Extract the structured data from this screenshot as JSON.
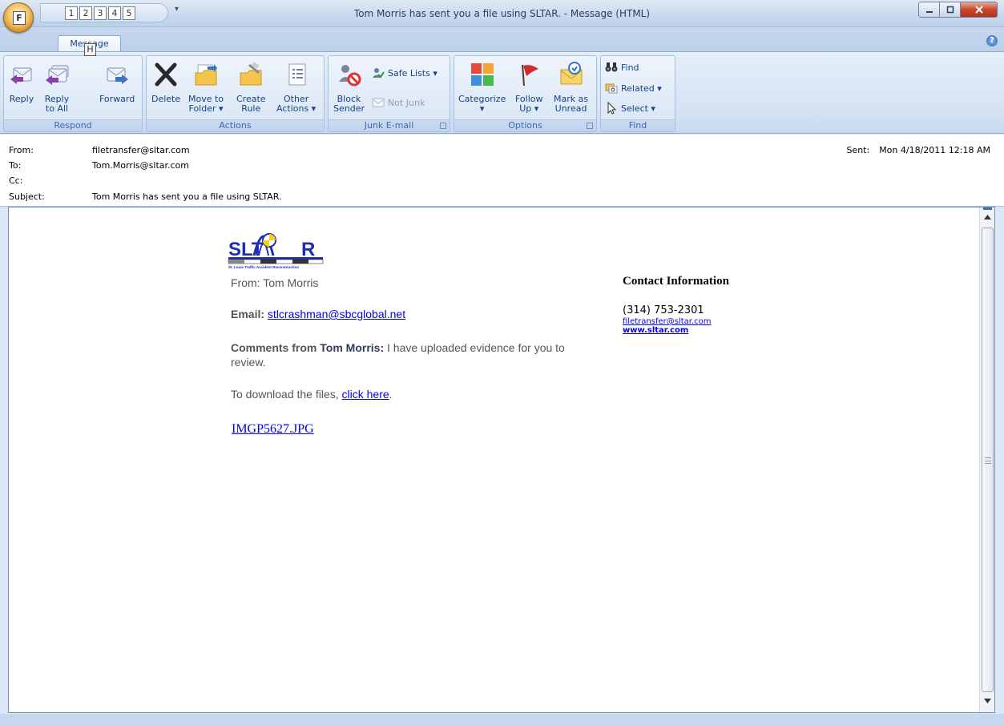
{
  "window": {
    "title": "Tom Morris has sent you a file using SLTAR. - Message (HTML)"
  },
  "office_button": {
    "keytip": "F"
  },
  "quick_access": {
    "keytips": [
      "1",
      "2",
      "3",
      "4",
      "5"
    ],
    "more": "▾"
  },
  "ribbon": {
    "tab": "Message",
    "tab_keytip": "H",
    "groups": {
      "respond": {
        "label": "Respond",
        "reply": "Reply",
        "reply_all_1": "Reply",
        "reply_all_2": "to All",
        "forward": "Forward"
      },
      "actions": {
        "label": "Actions",
        "delete": "Delete",
        "move_1": "Move to",
        "move_2": "Folder ▾",
        "rule_1": "Create",
        "rule_2": "Rule",
        "other_1": "Other",
        "other_2": "Actions ▾"
      },
      "junk": {
        "label": "Junk E-mail",
        "block_1": "Block",
        "block_2": "Sender",
        "safe_lists": "Safe Lists ▾",
        "not_junk": "Not Junk"
      },
      "options": {
        "label": "Options",
        "categorize_1": "Categorize",
        "categorize_2": "▾",
        "follow_1": "Follow",
        "follow_2": "Up ▾",
        "mark_1": "Mark as",
        "mark_2": "Unread"
      },
      "find": {
        "label": "Find",
        "find": "Find",
        "related": "Related ▾",
        "select": "Select ▾"
      }
    }
  },
  "header": {
    "from_label": "From:",
    "from": "filetransfer@sltar.com",
    "to_label": "To:",
    "to": "Tom.Morris@sltar.com",
    "cc_label": "Cc:",
    "cc": "",
    "subject_label": "Subject:",
    "subject": "Tom Morris has sent you a file using SLTAR.",
    "sent_label": "Sent:",
    "sent": "Mon 4/18/2011 12:18 AM"
  },
  "message": {
    "logo_text_1": "SLT",
    "logo_text_2": "R",
    "logo_caption": "St. Louis Traffic Accident Reconstruction",
    "from_line": "From: Tom Morris",
    "email_label": "Email:",
    "email": "stlcrashman@sbcglobal.net",
    "comments_label": "Comments from",
    "comments_name": "Tom Morris:",
    "comments_text_1": " I have uploaded evidence for you to",
    "comments_text_2": "review.",
    "download_text": "To download the files, ",
    "download_link": "click here",
    "download_end": ".",
    "file_link": "IMGP5627.JPG"
  },
  "contact": {
    "title": "Contact Information",
    "phone": "(314) 753-2301",
    "email": "filetransfer@sltar.com",
    "website": "www.sltar.com"
  },
  "colors": {
    "ribbon_text": "#15428b",
    "link": "#0000ee",
    "logo_blue": "#1c2fb0"
  }
}
